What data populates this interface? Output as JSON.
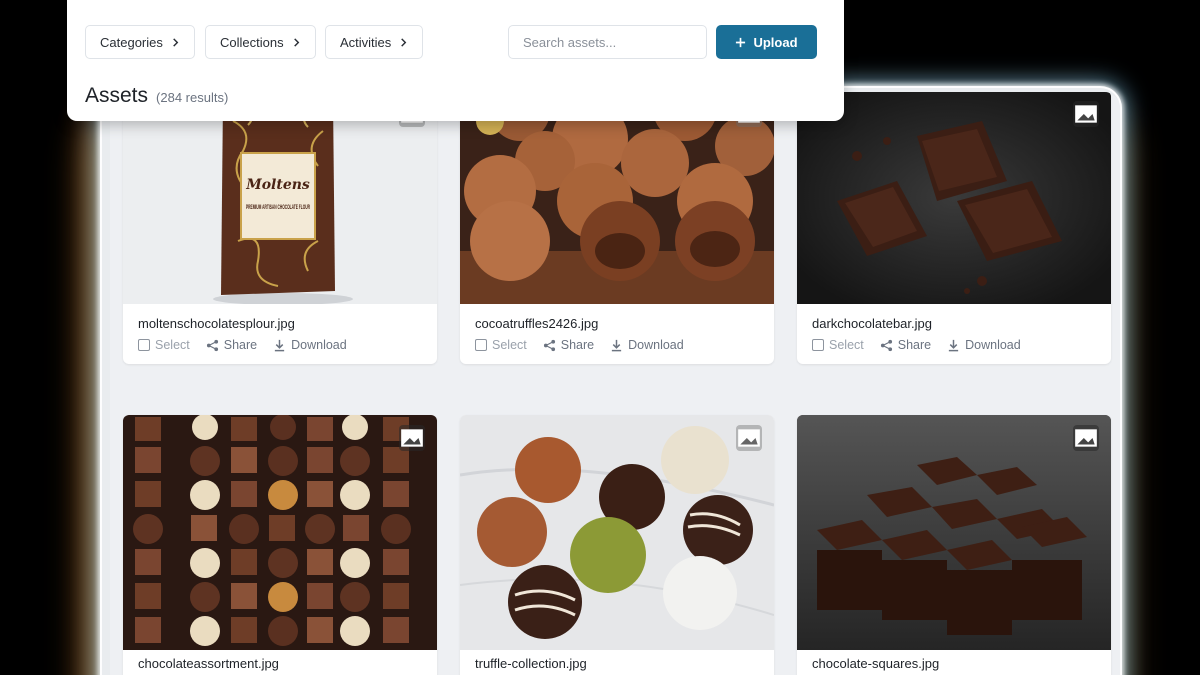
{
  "toolbar": {
    "filters": [
      {
        "label": "Categories"
      },
      {
        "label": "Collections"
      },
      {
        "label": "Activities"
      }
    ],
    "search_placeholder": "Search assets...",
    "upload_label": "Upload"
  },
  "page": {
    "title": "Assets",
    "result_count": "(284 results)"
  },
  "card_actions": {
    "select": "Select",
    "share": "Share",
    "download": "Download"
  },
  "assets": [
    {
      "filename": "moltenschocolatesplour.jpg",
      "image": "chocolate-flour-bag",
      "package_brand": "Moltens",
      "package_text": "PREMIUM ARTISAN CHOCOLATE FLOUR"
    },
    {
      "filename": "cocoatruffles2426.jpg",
      "image": "cocoa-truffles"
    },
    {
      "filename": "darkchocolatebar.jpg",
      "image": "dark-chocolate-bar"
    },
    {
      "filename": "chocolateassortment.jpg",
      "image": "chocolate-assortment-box"
    },
    {
      "filename": "truffle-collection.jpg",
      "image": "truffle-collection"
    },
    {
      "filename": "chocolate-squares.jpg",
      "image": "chocolate-squares"
    }
  ],
  "colors": {
    "accent": "#1a6f97",
    "background": "#000000",
    "glow": "#78d2ff"
  }
}
